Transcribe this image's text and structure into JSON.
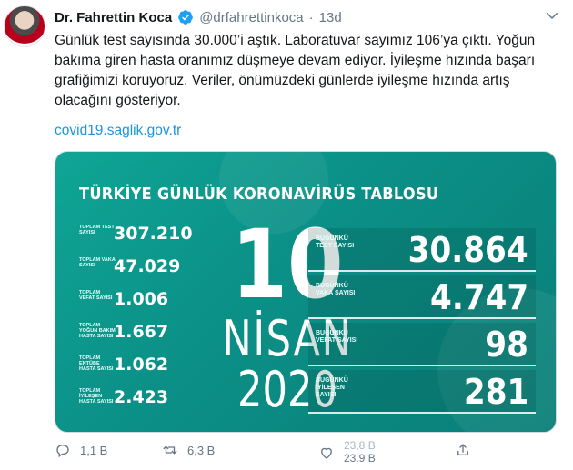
{
  "author": {
    "name": "Dr. Fahrettin Koca",
    "handle": "@drfahrettinkoca",
    "separator": "·",
    "time": "13d"
  },
  "tweet": {
    "text": "Günlük test sayısında 30.000’i aştık. Laboratuvar sayımız 106’ya çıktı. Yoğun bakıma giren hasta oranımız düşmeye devam ediyor. İyileşme hızında başarı grafiğimizi koruyoruz. Veriler, önümüzdeki günlerde iyileşme hızında artış olacağını gösteriyor.",
    "link": "covid19.saglik.gov.tr"
  },
  "card": {
    "title": "TÜRKİYE GÜNLÜK KORONAVİRÜS TABLOSU",
    "date": {
      "day": "10",
      "month": "NİSAN",
      "year": "2020"
    },
    "totals": [
      {
        "label": "TOPLAM TEST SAYISI",
        "value": "307.210"
      },
      {
        "label": "TOPLAM VAKA SAYISI",
        "value": "47.029"
      },
      {
        "label": "TOPLAM VEFAT SAYISI",
        "value": "1.006"
      },
      {
        "label": "TOPLAM YOĞUN BAKIM HASTA SAYISI",
        "value": "1.667"
      },
      {
        "label": "TOPLAM ENTÜBE HASTA SAYISI",
        "value": "1.062"
      },
      {
        "label": "TOPLAM İYİLEŞEN HASTA SAYISI",
        "value": "2.423"
      }
    ],
    "daily": [
      {
        "label": "BUGÜNKÜ TEST SAYISI",
        "value": "30.864"
      },
      {
        "label": "BUGÜNKÜ VAKA SAYISI",
        "value": "4.747"
      },
      {
        "label": "BUGÜNKÜ VEFAT SAYISI",
        "value": "98"
      },
      {
        "label": "BUGÜNKÜ İYİLEŞEN SAYISI",
        "value": "281"
      }
    ]
  },
  "actions": {
    "replies": "1,1 B",
    "retweets": "6,3 B",
    "likes_prev": "23,8 B",
    "likes": "23.9 B"
  },
  "colors": {
    "accent": "#1b95e0",
    "card_bg": "#0fa595",
    "muted": "#657786"
  },
  "icons": [
    "verified-badge-icon",
    "chevron-down-icon",
    "reply-icon",
    "retweet-icon",
    "like-icon",
    "share-icon"
  ]
}
